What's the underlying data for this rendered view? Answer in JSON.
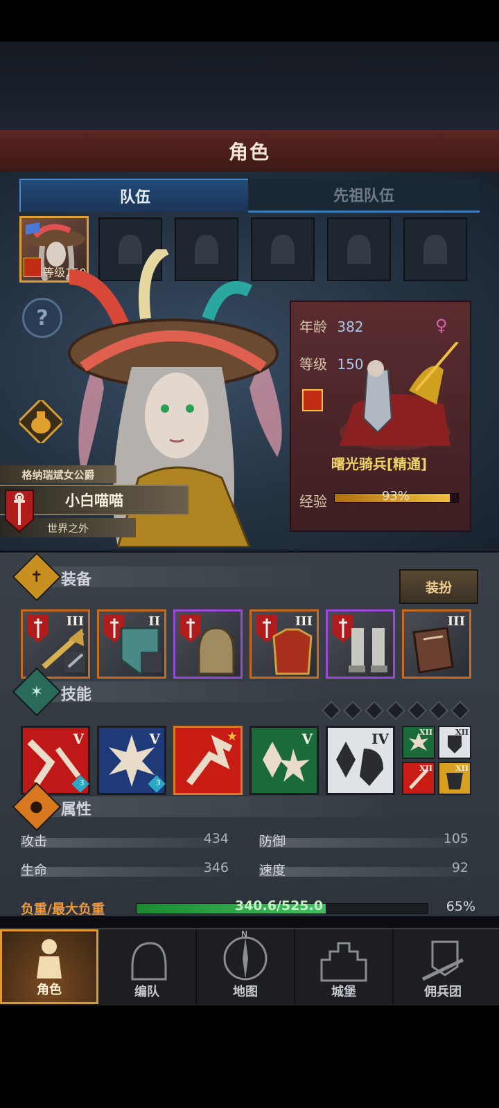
{
  "header": {
    "title": "角色"
  },
  "tabs": [
    {
      "label": "队伍",
      "active": true
    },
    {
      "label": "先祖队伍",
      "active": false
    }
  ],
  "party": {
    "portrait_level": "等级150"
  },
  "character": {
    "title": "格纳瑞斌女公爵",
    "name": "小白喵喵",
    "realm": "世界之外",
    "age_label": "年龄",
    "age": "382",
    "level_label": "等级",
    "level": "150",
    "unit_class": "曙光骑兵[精通]",
    "exp_label": "经验",
    "exp_percent": "93%",
    "exp_fraction": 0.93
  },
  "equipment": {
    "title": "装备",
    "dress_button": "装扮",
    "items": [
      {
        "name": "halberd",
        "tier": "III",
        "rarity": "orange"
      },
      {
        "name": "shield",
        "tier": "II",
        "rarity": "orange"
      },
      {
        "name": "helmet",
        "tier": "",
        "rarity": "purple"
      },
      {
        "name": "armor",
        "tier": "III",
        "rarity": "orange"
      },
      {
        "name": "greaves",
        "tier": "",
        "rarity": "purple"
      },
      {
        "name": "book",
        "tier": "III",
        "rarity": "orange"
      }
    ]
  },
  "skills": {
    "title": "技能",
    "slots_total": 7,
    "items": [
      {
        "name": "lance-charge",
        "tier": "V",
        "badge": "3",
        "color": "#c01818"
      },
      {
        "name": "radiant-burst",
        "tier": "V",
        "badge": "3",
        "color": "#1e3a78"
      },
      {
        "name": "rider-strike",
        "tier": "",
        "badge": "",
        "color": "#c81c14"
      },
      {
        "name": "crystal-shatter",
        "tier": "V",
        "badge": "",
        "color": "#1a6a3a"
      },
      {
        "name": "crystal-shield",
        "tier": "IV",
        "badge": "",
        "color": "#dfe2e6"
      }
    ],
    "mini": [
      {
        "name": "burst-mini",
        "tier": "XII",
        "color": "#1a6a3a"
      },
      {
        "name": "shield-mini",
        "tier": "XII",
        "color": "#dfe2e6"
      },
      {
        "name": "sword-mini",
        "tier": "XII",
        "color": "#c81c14"
      },
      {
        "name": "armor-mini",
        "tier": "XII",
        "color": "#d8a020"
      }
    ]
  },
  "attributes": {
    "title": "属性",
    "attack_label": "攻击",
    "attack": "434",
    "defense_label": "防御",
    "defense": "105",
    "life_label": "生命",
    "life": "346",
    "speed_label": "速度",
    "speed": "92",
    "load_label": "负重/最大负重",
    "load_text": "340.6/525.0",
    "load_percent": "65%",
    "load_fraction": 0.65
  },
  "nav": [
    {
      "label": "角色",
      "icon": "knight-icon",
      "active": true
    },
    {
      "label": "编队",
      "icon": "helmet-icon",
      "active": false
    },
    {
      "label": "地图",
      "icon": "compass-icon",
      "active": false,
      "compass_n": "N"
    },
    {
      "label": "城堡",
      "icon": "castle-icon",
      "active": false
    },
    {
      "label": "佣兵团",
      "icon": "banner-icon",
      "active": false
    }
  ]
}
